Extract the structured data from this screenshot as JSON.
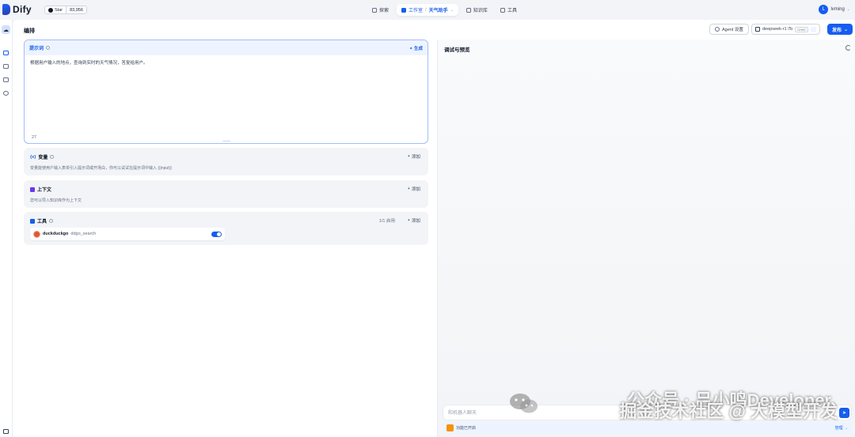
{
  "header": {
    "logo_text": "Dify",
    "github_label": "Star",
    "github_count": "83,956",
    "nav": [
      {
        "label": "探索"
      },
      {
        "label": "工作室"
      },
      {
        "label": "知识库"
      },
      {
        "label": "工具"
      }
    ],
    "current_app": "天气助手",
    "user_initial": "L",
    "user_name": "lvming"
  },
  "editor": {
    "title": "编排",
    "agent_settings": "Agent 设置",
    "model_name": "deepseek-r1:7b",
    "model_mode": "CHAT",
    "publish": "发布"
  },
  "prompt": {
    "title": "提示词",
    "generate": "生成",
    "text": "根据用户输入的地点，查询到实时的天气情况，答复给用户。",
    "char_count": "27"
  },
  "variables": {
    "icon": "{x}",
    "title": "变量",
    "add": "添加",
    "desc": "变量能使用户输入表单引入提示词或开场白，你可以试试在提示词中输入 {{input}}"
  },
  "context": {
    "title": "上下文",
    "add": "添加",
    "desc": "您可以导入知识库作为上下文"
  },
  "tools": {
    "title": "工具",
    "count": "1/1 启用",
    "add": "添加",
    "items": [
      {
        "provider": "duckduckgo",
        "name": "ddgo_search",
        "enabled": true
      }
    ]
  },
  "debug": {
    "title": "调试与预览",
    "input_placeholder": "和机器人聊天",
    "feature_text": "功能已开启",
    "manage": "管理"
  },
  "watermark": {
    "line1": "公众号 · 吕小鸣Developer",
    "line2": "掘金技术社区 @ 大模型开发"
  },
  "colors": {
    "accent": "#155eef",
    "background": "#f2f4f7",
    "prompt_border": "#a4bcfd"
  }
}
